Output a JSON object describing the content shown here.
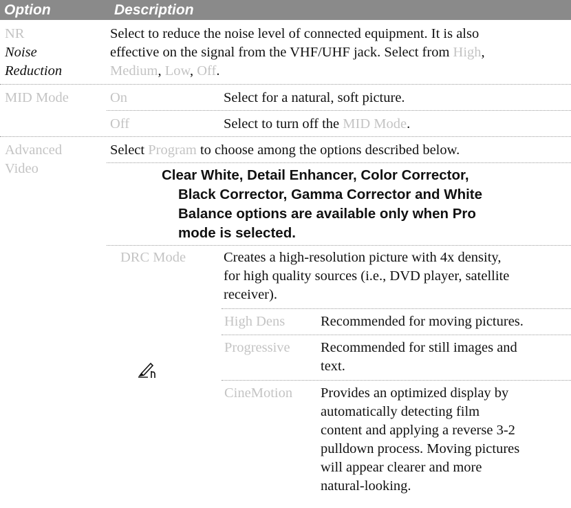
{
  "header": {
    "option_label": "Option",
    "description_label": "Description"
  },
  "nr": {
    "code": "NR",
    "title_line1": "Noise",
    "title_line2": "Reduction",
    "desc_line1": "Select to reduce the noise level of connected equipment. It is also",
    "desc_line2_pre": "effective on the signal from the VHF/UHF jack. Select from ",
    "opt_high": "High",
    "line3_comma_a": ",",
    "opt_medium": "Medium",
    "line3_comma_b": ", ",
    "opt_low": "Low",
    "line3_comma_c": ", ",
    "opt_off": "Off",
    "line3_period": "."
  },
  "mid": {
    "label": "MID Mode",
    "on_label": "On",
    "on_desc": "Select for a natural, soft picture.",
    "off_label": "Off",
    "off_desc_pre": "Select to turn off the ",
    "off_desc_mode": "MID Mode",
    "off_desc_post": "."
  },
  "adv": {
    "label_line1": "Advanced",
    "label_line2": "Video",
    "select_pre": "Select ",
    "select_program": "Program",
    "select_post": " to choose among the options described below.",
    "note_line1": "Clear White, Detail Enhancer, Color Corrector,",
    "note_line2": "Black Corrector, Gamma Corrector and White",
    "note_line3": "Balance options are available only when Pro",
    "note_line4": "mode is selected."
  },
  "drc": {
    "label": "DRC Mode",
    "desc_line1": "Creates a high-resolution picture with 4x density,",
    "desc_line2": "for high quality sources (i.e., DVD player, satellite",
    "desc_line3": "receiver).",
    "high_density_label": "High Dens",
    "high_density_desc": "Recommended for moving pictures.",
    "progressive_label": "Progressive",
    "progressive_desc_line1": "Recommended for still images and",
    "progressive_desc_line2": "text.",
    "cinemotion_label": "CineMotion",
    "cinemotion_line1": "Provides an optimized display by",
    "cinemotion_line2": "automatically detecting film",
    "cinemotion_line3": "content and applying a reverse 3-2",
    "cinemotion_line4": "pulldown process. Moving pictures",
    "cinemotion_line5": "will appear clearer and more",
    "cinemotion_line6": "natural-looking."
  }
}
